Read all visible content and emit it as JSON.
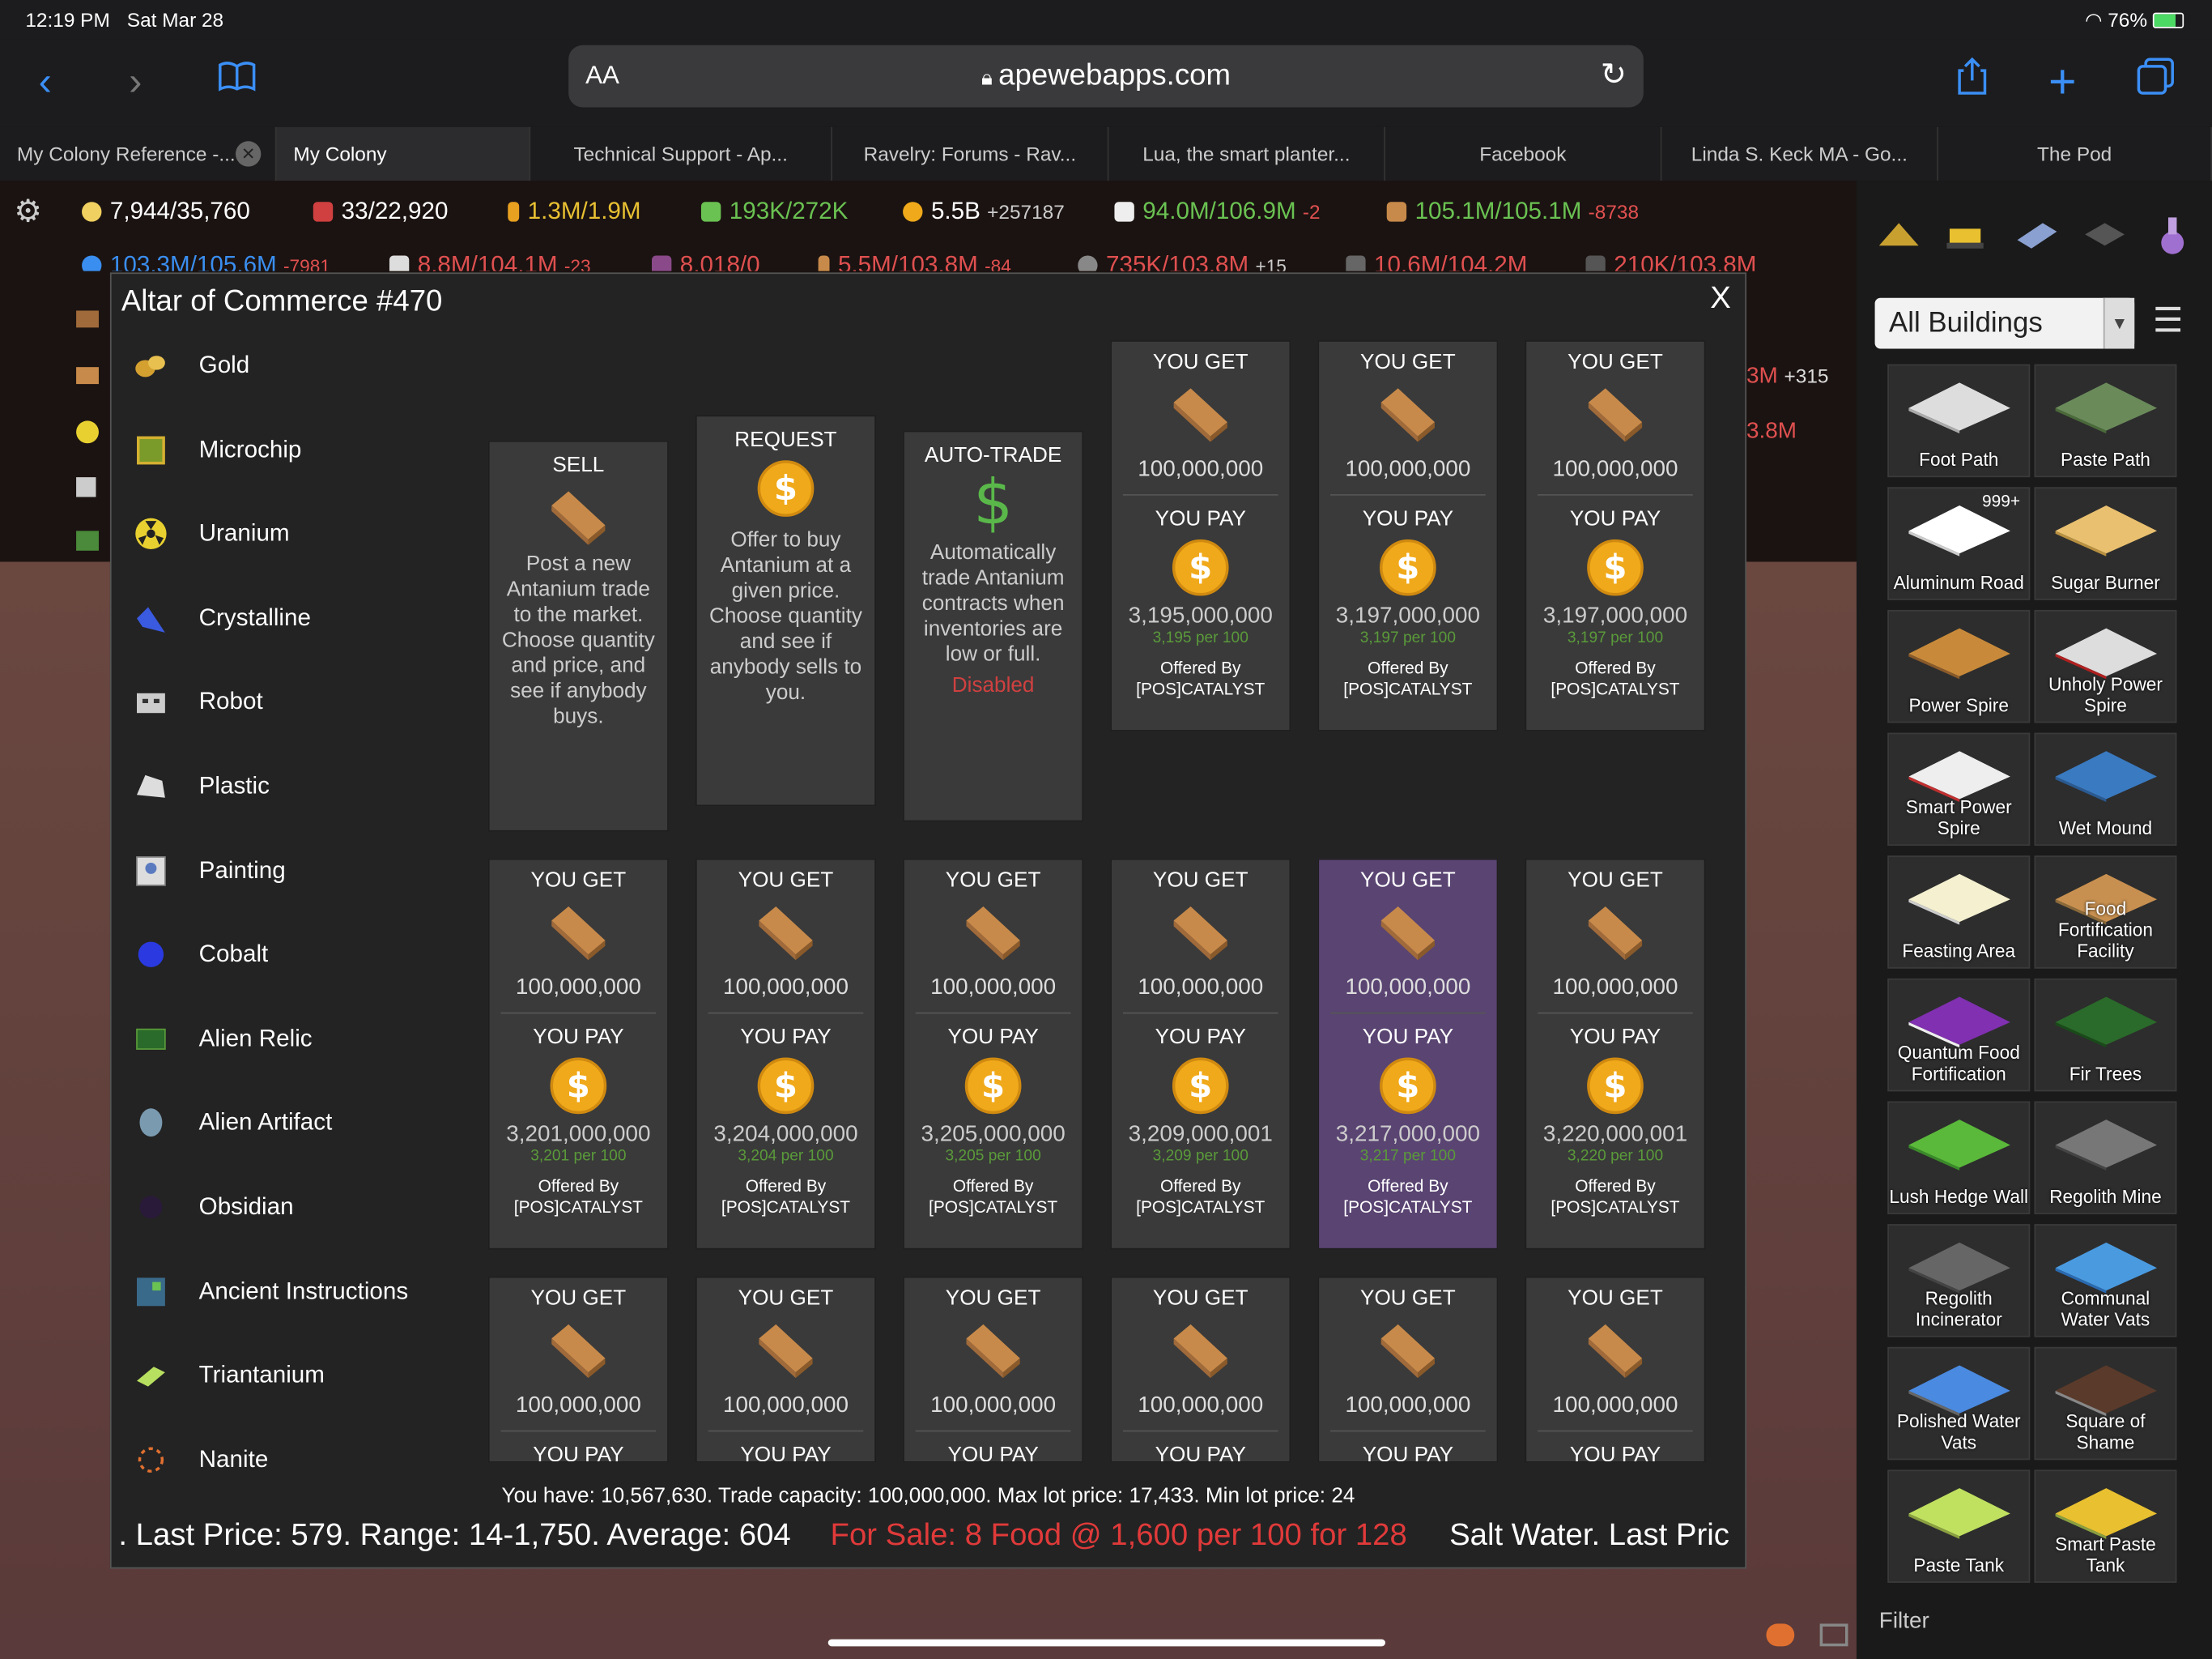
{
  "status": {
    "time": "12:19 PM",
    "date": "Sat Mar 28",
    "battery": "76%"
  },
  "browser": {
    "aa": "AA",
    "url": "apewebapps.com"
  },
  "tabs": [
    "My Colony Reference -...",
    "My Colony",
    "Technical Support - Ap...",
    "Ravelry: Forums - Rav...",
    "Lua, the smart planter...",
    "Facebook",
    "Linda S. Keck MA - Go...",
    "The Pod"
  ],
  "resources": {
    "row1": [
      {
        "value": "7,944/35,760",
        "delta": "",
        "color": "#ffffff"
      },
      {
        "value": "33/22,920",
        "delta": "",
        "color": "#ffffff"
      },
      {
        "value": "1.3M/1.9M",
        "delta": "",
        "color": "#e8c032"
      },
      {
        "value": "193K/272K",
        "delta": "",
        "color": "#6ac252"
      },
      {
        "value": "5.5B",
        "delta": "+257187",
        "color": "#ffffff"
      },
      {
        "value": "94.0M/106.9M",
        "delta": "-2",
        "color": "#6ac252"
      },
      {
        "value": "105.1M/105.1M",
        "delta": "-8738",
        "color": "#6ac252"
      }
    ],
    "row2": [
      {
        "value": "103.3M/105.6M",
        "delta": "-7981",
        "color": "#3a8ef0"
      },
      {
        "value": "8.8M/104.1M",
        "delta": "-23",
        "color": "#e05050"
      },
      {
        "value": "8,018/0",
        "delta": "",
        "color": "#e05050"
      },
      {
        "value": "5.5M/103.8M",
        "delta": "-84",
        "color": "#e05050"
      },
      {
        "value": "735K/103.8M",
        "delta": "+15",
        "color": "#e05050"
      },
      {
        "value": "10.6M/104.2M",
        "delta": "",
        "color": "#e05050"
      },
      {
        "value": "210K/103.8M",
        "delta": "",
        "color": "#e05050"
      }
    ],
    "side1": {
      "value": "3M",
      "delta": "+315"
    },
    "side2": {
      "value": "3.8M"
    }
  },
  "modal": {
    "title": "Altar of Commerce #470",
    "close": "X",
    "categories": [
      "Gold",
      "Microchip",
      "Uranium",
      "Crystalline",
      "Robot",
      "Plastic",
      "Painting",
      "Cobalt",
      "Alien Relic",
      "Alien Artifact",
      "Obsidian",
      "Ancient Instructions",
      "Triantanium",
      "Nanite"
    ],
    "actions": {
      "sell": {
        "title": "SELL",
        "text": "Post a new Antanium trade to the market. Choose quantity and price, and see if anybody buys."
      },
      "request": {
        "title": "REQUEST",
        "text": "Offer to buy Antanium at a given price. Choose quantity and see if anybody sells to you."
      },
      "autotrade": {
        "title": "AUTO-TRADE",
        "text": "Automatically trade Antanium contracts when inventories are low or full.",
        "state": "Disabled"
      }
    },
    "labels": {
      "get": "YOU GET",
      "pay": "YOU PAY",
      "offered": "Offered By"
    },
    "offers": [
      {
        "get": "100,000,000",
        "pay": "3,195,000,000",
        "per": "3,195 per 100",
        "by": "[POS]CATALYST"
      },
      {
        "get": "100,000,000",
        "pay": "3,197,000,000",
        "per": "3,197 per 100",
        "by": "[POS]CATALYST"
      },
      {
        "get": "100,000,000",
        "pay": "3,197,000,000",
        "per": "3,197 per 100",
        "by": "[POS]CATALYST"
      },
      {
        "get": "100,000,000",
        "pay": "3,201,000,000",
        "per": "3,201 per 100",
        "by": "[POS]CATALYST"
      },
      {
        "get": "100,000,000",
        "pay": "3,204,000,000",
        "per": "3,204 per 100",
        "by": "[POS]CATALYST"
      },
      {
        "get": "100,000,000",
        "pay": "3,205,000,000",
        "per": "3,205 per 100",
        "by": "[POS]CATALYST"
      },
      {
        "get": "100,000,000",
        "pay": "3,209,000,001",
        "per": "3,209 per 100",
        "by": "[POS]CATALYST"
      },
      {
        "get": "100,000,000",
        "pay": "3,217,000,000",
        "per": "3,217 per 100",
        "by": "[POS]CATALYST"
      },
      {
        "get": "100,000,000",
        "pay": "3,220,000,001",
        "per": "3,220 per 100",
        "by": "[POS]CATALYST"
      },
      {
        "get": "100,000,000"
      },
      {
        "get": "100,000,000"
      },
      {
        "get": "100,000,000"
      },
      {
        "get": "100,000,000"
      },
      {
        "get": "100,000,000"
      },
      {
        "get": "100,000,000"
      }
    ],
    "info": "You have: 10,567,630. Trade capacity: 100,000,000. Max lot price: 17,433. Min lot price: 24",
    "ticker": {
      "a": ". Last Price: 579. Range: 14-1,750. Average: 604",
      "b": "For Sale: 8 Food @ 1,600 per 100 for 128",
      "c": "Salt Water. Last Pric"
    }
  },
  "panel": {
    "dropdown": "All Buildings",
    "buildings": [
      {
        "name": "Foot Path"
      },
      {
        "name": "Paste Path"
      },
      {
        "name": "Aluminum Road",
        "count": "999+"
      },
      {
        "name": "Sugar Burner"
      },
      {
        "name": "Power Spire"
      },
      {
        "name": "Unholy Power Spire"
      },
      {
        "name": "Smart Power Spire"
      },
      {
        "name": "Wet Mound"
      },
      {
        "name": "Feasting Area"
      },
      {
        "name": "Food Fortification Facility"
      },
      {
        "name": "Quantum Food Fortification"
      },
      {
        "name": "Fir Trees"
      },
      {
        "name": "Lush Hedge Wall"
      },
      {
        "name": "Regolith Mine"
      },
      {
        "name": "Regolith Incinerator"
      },
      {
        "name": "Communal Water Vats"
      },
      {
        "name": "Polished Water Vats"
      },
      {
        "name": "Square of Shame"
      },
      {
        "name": "Paste Tank"
      },
      {
        "name": "Smart Paste Tank"
      }
    ],
    "filter": "Filter"
  },
  "colors": {
    "selected_offer": "#5a4472",
    "coin": "#f0a91a",
    "bar": "#c88a4a",
    "disabled": "#d04040",
    "ticker_sale": "#e03a3a"
  }
}
